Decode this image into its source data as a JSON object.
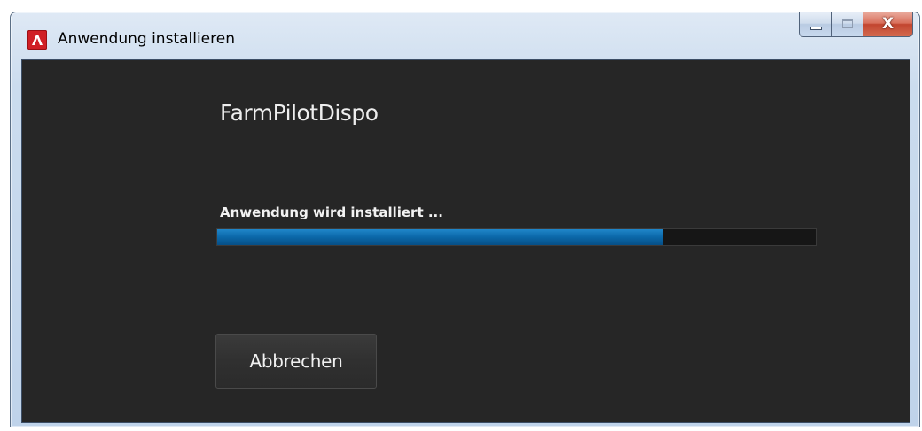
{
  "window": {
    "title": "Anwendung installieren",
    "app_icon": "adobe-air-icon",
    "caption": {
      "minimize_icon": "minimize-icon",
      "maximize_icon": "maximize-icon",
      "close_icon": "close-icon",
      "close_glyph": "X"
    }
  },
  "installer": {
    "app_name": "FarmPilotDispo",
    "status": "Anwendung wird installiert ...",
    "progress_fraction": 0.745,
    "cancel_label": "Abbrechen"
  },
  "colors": {
    "background": "#262626",
    "progress_accent": "#0b67a8",
    "close_button": "#c2452f",
    "icon_red": "#d01f25"
  }
}
